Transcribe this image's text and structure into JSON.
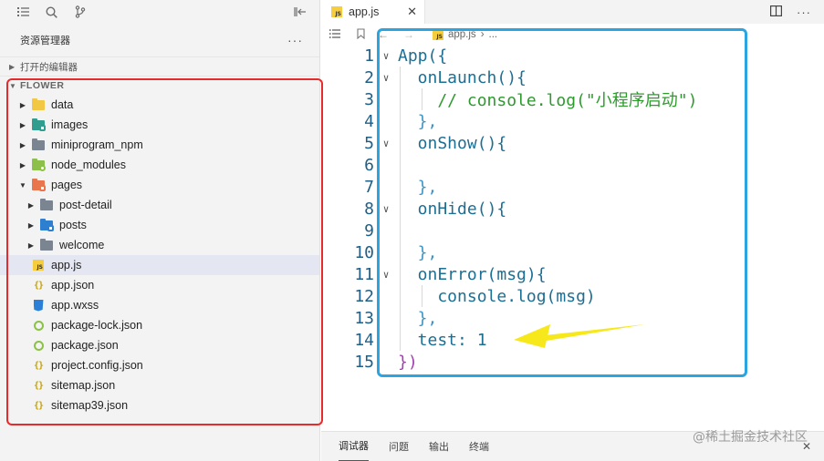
{
  "sidebar": {
    "toolbar": {
      "icons": [
        "list-icon",
        "search-icon",
        "branch-icon",
        "collapse-panel-icon"
      ]
    },
    "header_title": "资源管理器",
    "more_label": "···",
    "open_editors_label": "打开的编辑器",
    "root_label": "FLOWER",
    "tree": [
      {
        "label": "data",
        "type": "folder",
        "color": "#f2c744",
        "badge": ""
      },
      {
        "label": "images",
        "type": "folder",
        "color": "#2f9e8f",
        "badge": "#2f9e8f"
      },
      {
        "label": "miniprogram_npm",
        "type": "folder",
        "color": "#7b8591",
        "badge": ""
      },
      {
        "label": "node_modules",
        "type": "folder",
        "color": "#8cc04b",
        "badge": "#8cc04b"
      },
      {
        "label": "pages",
        "type": "folder",
        "color": "#e8754c",
        "badge": "#e8754c",
        "expanded": true
      },
      {
        "label": "post-detail",
        "type": "folder",
        "color": "#7b8591",
        "badge": "",
        "level": 1
      },
      {
        "label": "posts",
        "type": "folder",
        "color": "#2f7fd0",
        "badge": "#2f7fd0",
        "level": 1
      },
      {
        "label": "welcome",
        "type": "folder",
        "color": "#7b8591",
        "badge": "",
        "level": 1
      },
      {
        "label": "app.js",
        "type": "js",
        "selected": true
      },
      {
        "label": "app.json",
        "type": "json"
      },
      {
        "label": "app.wxss",
        "type": "css"
      },
      {
        "label": "package-lock.json",
        "type": "npm"
      },
      {
        "label": "package.json",
        "type": "npm"
      },
      {
        "label": "project.config.json",
        "type": "json"
      },
      {
        "label": "sitemap.json",
        "type": "json"
      },
      {
        "label": "sitemap39.json",
        "type": "json"
      }
    ]
  },
  "editor": {
    "tab_label": "app.js",
    "breadcrumb_file": "app.js",
    "breadcrumb_more": "...",
    "lines": [
      {
        "n": "1",
        "fold": "v",
        "code": "App({"
      },
      {
        "n": "2",
        "fold": "v",
        "code": "  onLaunch(){"
      },
      {
        "n": "3",
        "fold": "",
        "code": "    // console.log(\"小程序启动\")"
      },
      {
        "n": "4",
        "fold": "",
        "code": "  },"
      },
      {
        "n": "5",
        "fold": "v",
        "code": "  onShow(){"
      },
      {
        "n": "6",
        "fold": "",
        "code": ""
      },
      {
        "n": "7",
        "fold": "",
        "code": "  },"
      },
      {
        "n": "8",
        "fold": "v",
        "code": "  onHide(){"
      },
      {
        "n": "9",
        "fold": "",
        "code": ""
      },
      {
        "n": "10",
        "fold": "",
        "code": "  },"
      },
      {
        "n": "11",
        "fold": "v",
        "code": "  onError(msg){"
      },
      {
        "n": "12",
        "fold": "",
        "code": "    console.log(msg)"
      },
      {
        "n": "13",
        "fold": "",
        "code": "  },"
      },
      {
        "n": "14",
        "fold": "",
        "code": "  test: 1"
      },
      {
        "n": "15",
        "fold": "",
        "code": "})"
      }
    ]
  },
  "panel": {
    "tabs": [
      "调试器",
      "问题",
      "输出",
      "终端"
    ],
    "active_tab": "调试器"
  },
  "watermark": "@稀土掘金技术社区",
  "colors": {
    "annotation_red": "#e52b2b",
    "annotation_blue": "#2ba4e0",
    "arrow_yellow": "#f6e81a"
  }
}
